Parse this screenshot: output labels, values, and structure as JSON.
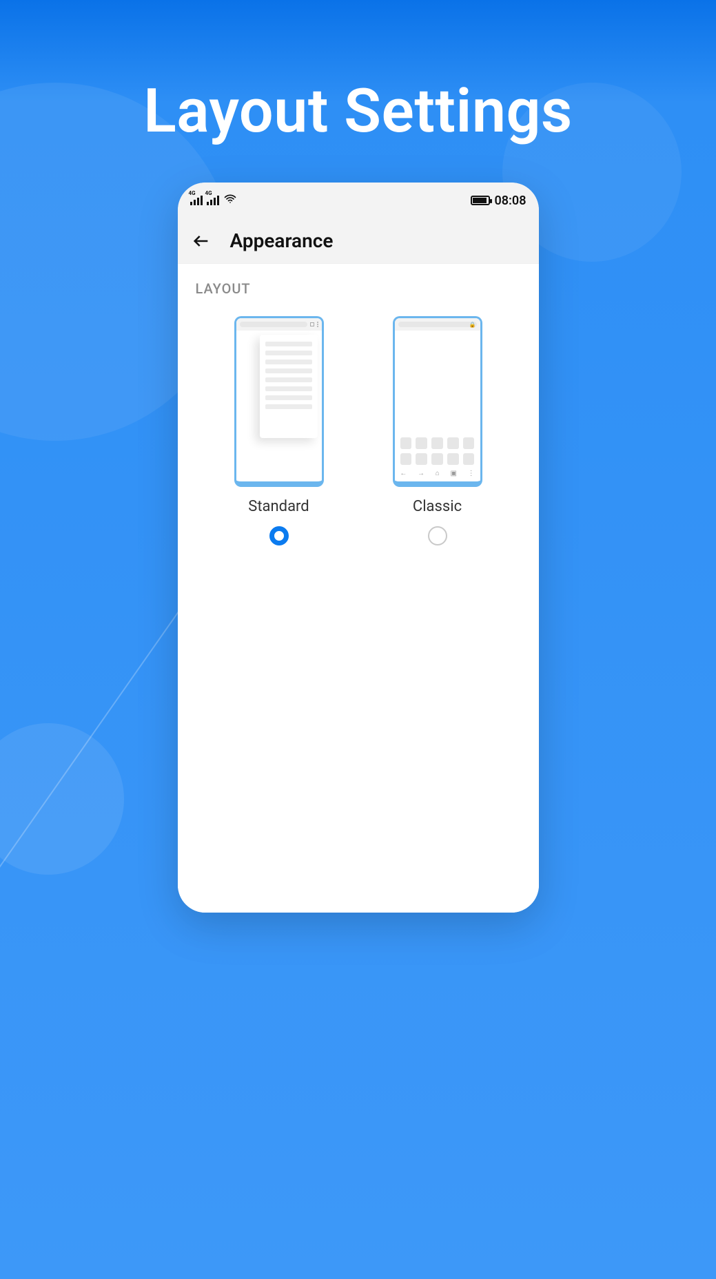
{
  "headline": "Layout Settings",
  "statusbar": {
    "time": "08:08"
  },
  "appbar": {
    "title": "Appearance"
  },
  "section": {
    "label": "LAYOUT"
  },
  "options": {
    "standard": {
      "label": "Standard",
      "selected": true
    },
    "classic": {
      "label": "Classic",
      "selected": false
    }
  }
}
